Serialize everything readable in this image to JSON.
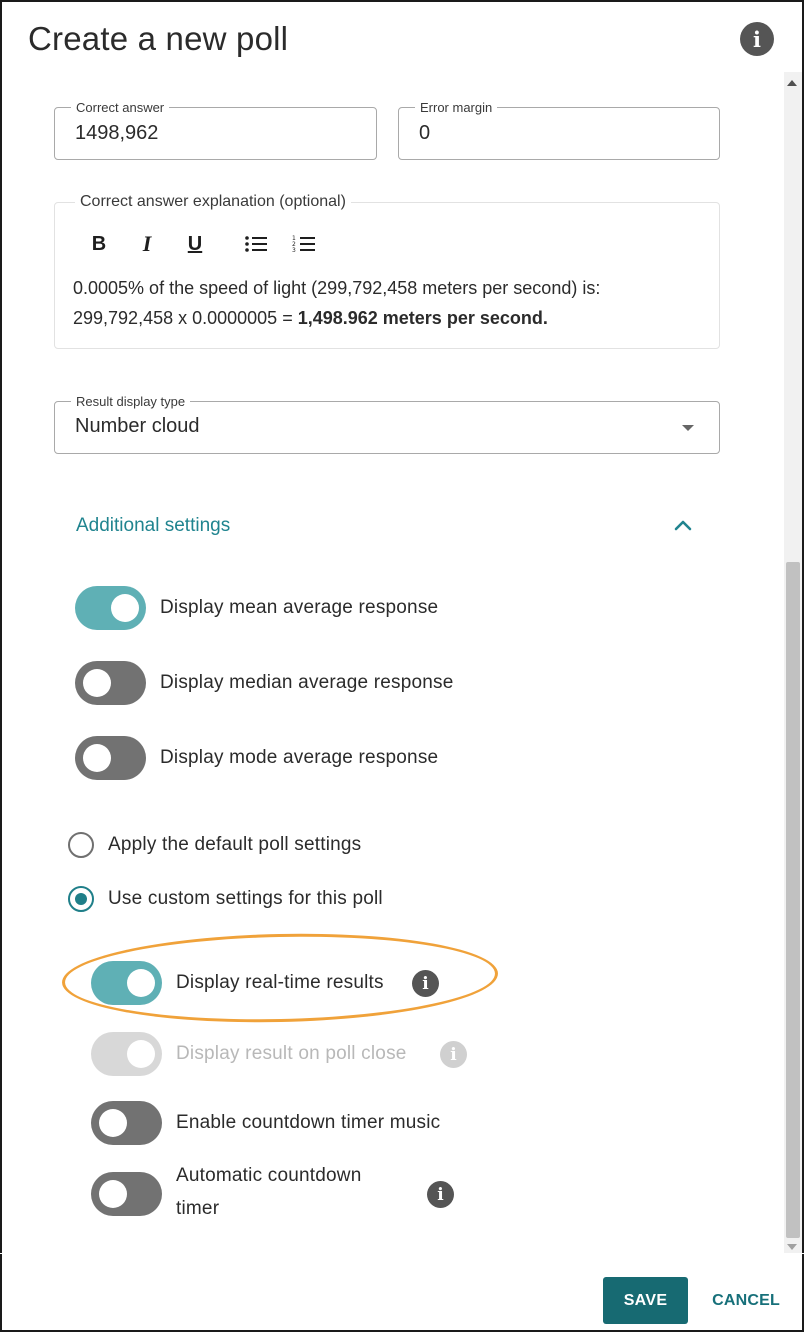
{
  "header": {
    "title": "Create a new poll",
    "info_icon": "info-icon"
  },
  "answer": {
    "correct_label": "Correct answer",
    "correct_value": "1498,962",
    "margin_label": "Error margin",
    "margin_value": "0"
  },
  "explanation": {
    "label": "Correct answer explanation (optional)",
    "toolbar": {
      "bold": "B",
      "italic": "I",
      "underline": "U",
      "bullet_icon": "bulleted-list-icon",
      "numbered_icon": "numbered-list-icon"
    },
    "line1": "0.0005% of the speed of light (299,792,458 meters per second) is:",
    "line2_plain": "299,792,458 x 0.0000005 = ",
    "line2_bold": "1,498.962 meters per second."
  },
  "result_display": {
    "label": "Result display type",
    "value": "Number cloud"
  },
  "additional": {
    "label": "Additional settings",
    "expanded": true,
    "toggles": [
      {
        "label": "Display mean average response",
        "on": true
      },
      {
        "label": "Display median average response",
        "on": false
      },
      {
        "label": "Display mode average response",
        "on": false
      }
    ]
  },
  "settings_mode": {
    "options": [
      {
        "label": "Apply the default poll settings",
        "checked": false
      },
      {
        "label": "Use custom settings for this poll",
        "checked": true
      }
    ]
  },
  "custom": {
    "toggles": [
      {
        "label": "Display real-time results",
        "on": true,
        "disabled": false,
        "info": true
      },
      {
        "label": "Display result on poll close",
        "on": true,
        "disabled": true,
        "info": true
      },
      {
        "label": "Enable countdown timer music",
        "on": false,
        "disabled": false,
        "info": false
      },
      {
        "label_line1": "Automatic countdown",
        "label_line2": "timer",
        "on": false,
        "disabled": false,
        "info": true
      }
    ]
  },
  "footer": {
    "save": "SAVE",
    "cancel": "CANCEL"
  },
  "colors": {
    "accent": "#20848f",
    "toggle_on": "#5fb0b5",
    "toggle_off": "#727272",
    "save_bg": "#176a72",
    "highlight": "#f0a23a"
  }
}
